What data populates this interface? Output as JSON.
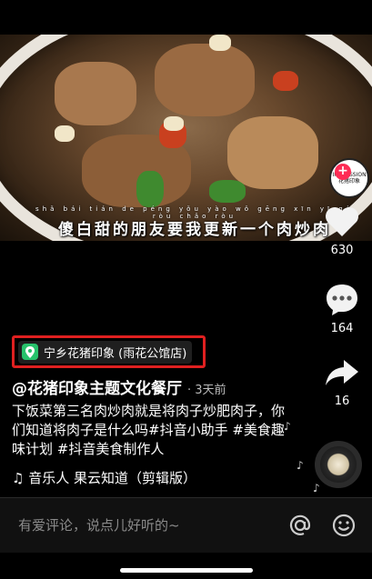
{
  "video": {
    "pinyin": "shǎ bái tián de péng yǒu yào wǒ gēng xīn yī gè ròu chǎo ròu",
    "subtitle": "傻白甜的朋友要我更新一个肉炒肉",
    "watermark_text": "IMPRESSION 花猪印象"
  },
  "actions": {
    "like_count": "630",
    "comment_count": "164",
    "share_count": "16"
  },
  "post": {
    "location": "宁乡花猪印象 (雨花公馆店)",
    "author": "@花猪印象主题文化餐厅",
    "time": "· 3天前",
    "description": "下饭菜第三名肉炒肉就是将肉子炒肥肉子，你们知道将肉子是什么吗#抖音小助手 #美食趣味计划 #抖音美食制作人",
    "music": "♫ 音乐人 果云知道（剪辑版）"
  },
  "comment_bar": {
    "placeholder": "有爱评论，说点儿好听的~"
  },
  "colors": {
    "highlight_box": "#e02020",
    "location_icon": "#27c26b",
    "follow_plus": "#fe2c55"
  }
}
